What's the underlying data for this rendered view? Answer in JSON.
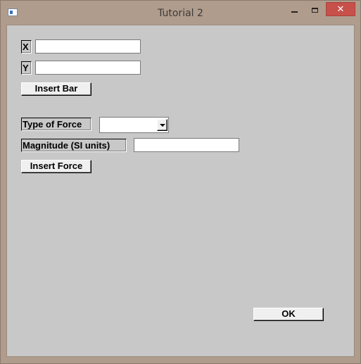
{
  "window": {
    "title": "Tutorial 2",
    "close_glyph": "✕"
  },
  "bar_section": {
    "x_label": "X",
    "x_value": "",
    "y_label": "Y",
    "y_value": "",
    "insert_bar_label": "Insert Bar"
  },
  "force_section": {
    "type_label": "Type of Force",
    "type_selected": "",
    "magnitude_label": "Magnitude (SI units)",
    "magnitude_value": "",
    "insert_force_label": "Insert Force"
  },
  "footer": {
    "ok_label": "OK"
  },
  "icons": {
    "app": "app-window-icon",
    "minimize": "minimize-icon",
    "maximize": "maximize-icon",
    "close": "close-icon",
    "dropdown": "chevron-down-icon"
  },
  "colors": {
    "frame": "#b09c8c",
    "client_bg": "#c8c8c8",
    "close_button": "#c7504a"
  }
}
